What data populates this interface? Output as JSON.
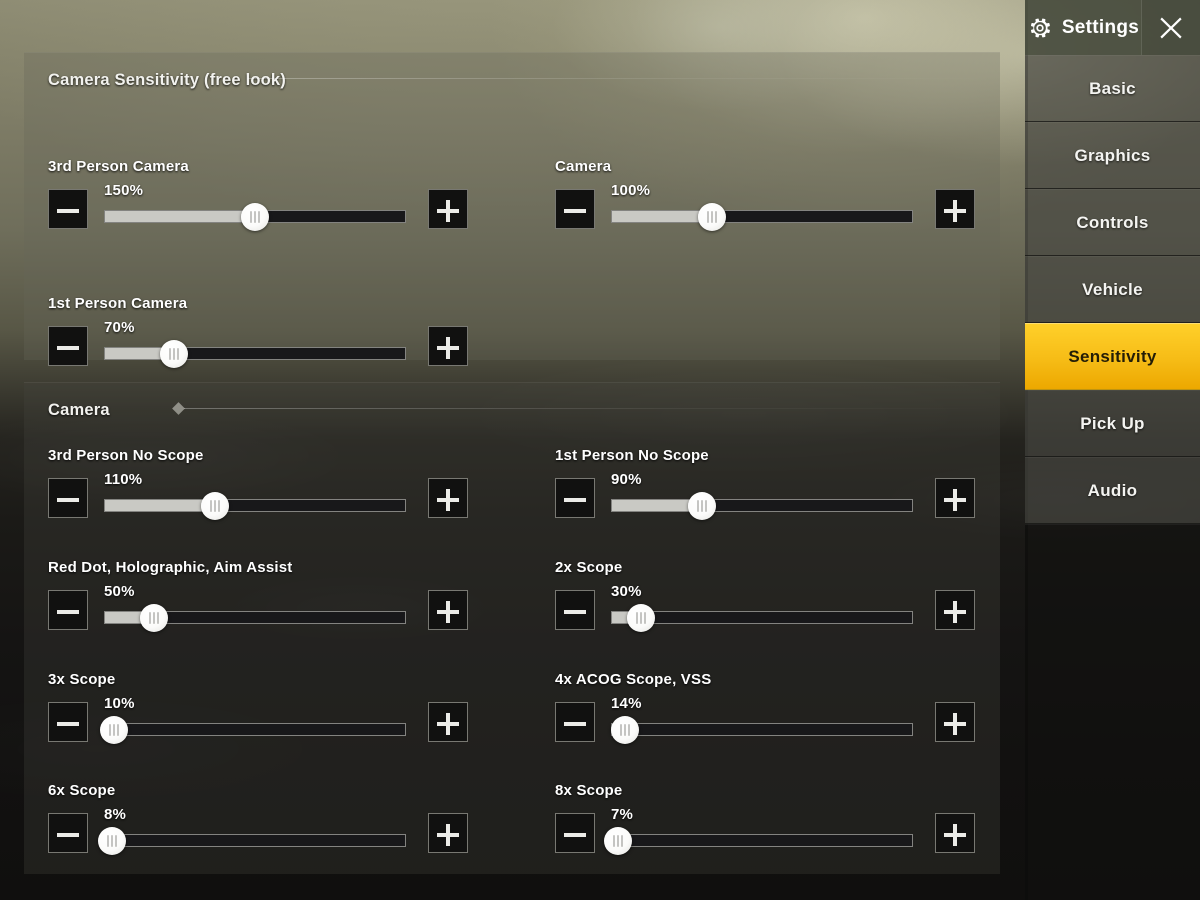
{
  "sidebar": {
    "header": {
      "title": "Settings",
      "gear_icon": "gear-icon",
      "close_icon": "close-x-icon"
    },
    "items": [
      {
        "label": "Basic",
        "active": false
      },
      {
        "label": "Graphics",
        "active": false
      },
      {
        "label": "Controls",
        "active": false
      },
      {
        "label": "Vehicle",
        "active": false
      },
      {
        "label": "Sensitivity",
        "active": true
      },
      {
        "label": "Pick Up",
        "active": false
      },
      {
        "label": "Audio",
        "active": false
      }
    ],
    "active_color": "#f6bc16",
    "active_text_color": "#241d06"
  },
  "panels": [
    {
      "id": "camera-sensitivity-free-look",
      "title": "Camera Sensitivity (free look)",
      "rows": [
        {
          "label": "3rd Person Camera",
          "value": "150%",
          "percent": 150,
          "max": 300,
          "column": "left"
        },
        {
          "label": "Camera",
          "value": "100%",
          "percent": 100,
          "max": 300,
          "column": "right"
        },
        {
          "label": "1st Person Camera",
          "value": "70%",
          "percent": 70,
          "max": 300,
          "column": "left"
        }
      ]
    },
    {
      "id": "camera",
      "title": "Camera",
      "rows": [
        {
          "label": "3rd Person No Scope",
          "value": "110%",
          "percent": 110,
          "max": 300,
          "column": "left"
        },
        {
          "label": "1st Person No Scope",
          "value": "90%",
          "percent": 90,
          "max": 300,
          "column": "right"
        },
        {
          "label": "Red Dot, Holographic, Aim Assist",
          "value": "50%",
          "percent": 50,
          "max": 300,
          "column": "left"
        },
        {
          "label": "2x Scope",
          "value": "30%",
          "percent": 30,
          "max": 300,
          "column": "right"
        },
        {
          "label": "3x Scope",
          "value": "10%",
          "percent": 10,
          "max": 300,
          "column": "left"
        },
        {
          "label": "4x ACOG Scope, VSS",
          "value": "14%",
          "percent": 14,
          "max": 300,
          "column": "right"
        },
        {
          "label": "6x Scope",
          "value": "8%",
          "percent": 8,
          "max": 300,
          "column": "left"
        },
        {
          "label": "8x Scope",
          "value": "7%",
          "percent": 7,
          "max": 300,
          "column": "right"
        }
      ]
    }
  ],
  "stepper": {
    "decrease_label": "−",
    "increase_label": "+"
  }
}
